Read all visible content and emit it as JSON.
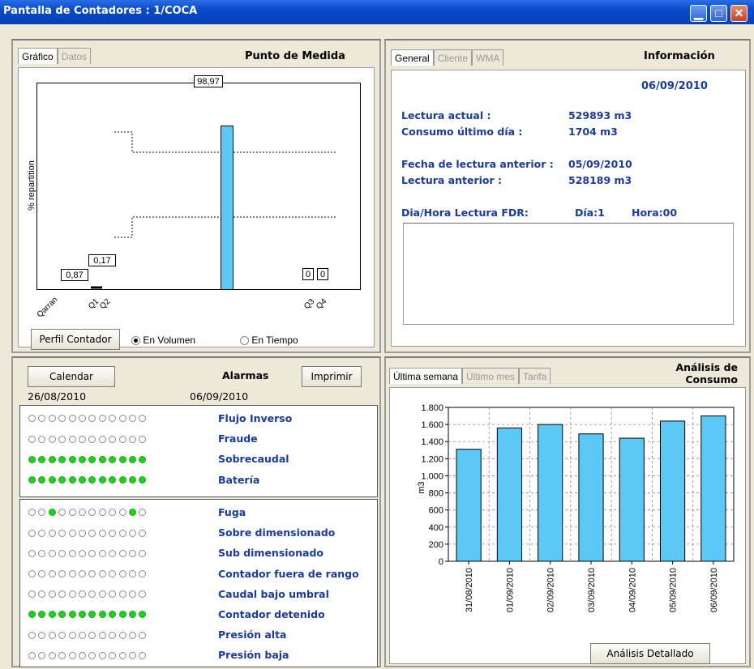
{
  "window": {
    "title": "Pantalla de Contadores : 1/COCA"
  },
  "icons": {
    "minimize": "minimize-icon",
    "maximize": "maximize-icon",
    "close": "close-icon"
  },
  "punto": {
    "title": "Punto de Medida",
    "tabs": [
      {
        "label": "Gráfico",
        "active": true
      },
      {
        "label": "Datos",
        "active": false
      }
    ],
    "ylabel": "% repartition",
    "value_labels": [
      "0,87",
      "0,17",
      "98,97",
      "0",
      "0"
    ],
    "ticks": [
      "Qarran",
      "Q1",
      "Q2",
      "Q3",
      "Q4"
    ],
    "bar_percent": 98.97,
    "perfil_button": "Perfil Contador",
    "radio_volumen": "En Volumen",
    "radio_tiempo": "En Tiempo",
    "selected": "En Volumen"
  },
  "info": {
    "title": "Información",
    "tabs": [
      {
        "label": "General",
        "active": true
      },
      {
        "label": "Cliente",
        "active": false
      },
      {
        "label": "WMA",
        "active": false
      }
    ],
    "date": "06/09/2010",
    "lectura_actual_label": "Lectura actual :",
    "lectura_actual_value": "529893 m3",
    "consumo_label": "Consumo último día :",
    "consumo_value": "1704 m3",
    "fecha_anterior_label": "Fecha de lectura anterior :",
    "fecha_anterior_value": "05/09/2010",
    "lectura_anterior_label": "Lectura anterior :",
    "lectura_anterior_value": "528189 m3",
    "fdr_label": "Dia/Hora Lectura FDR:",
    "fdr_dia": "Día:1",
    "fdr_hora": "Hora:00"
  },
  "alarmas": {
    "title": "Alarmas",
    "calendar_button": "Calendar",
    "print_button": "Imprimir",
    "date_from": "26/08/2010",
    "date_to": "06/09/2010",
    "group1": [
      {
        "label": "Flujo Inverso",
        "dots": [
          0,
          0,
          0,
          0,
          0,
          0,
          0,
          0,
          0,
          0,
          0,
          0
        ]
      },
      {
        "label": "Fraude",
        "dots": [
          0,
          0,
          0,
          0,
          0,
          0,
          0,
          0,
          0,
          0,
          0,
          0
        ]
      },
      {
        "label": "Sobrecaudal",
        "dots": [
          1,
          1,
          1,
          1,
          1,
          1,
          1,
          1,
          1,
          1,
          1,
          1
        ]
      },
      {
        "label": "Batería",
        "dots": [
          1,
          1,
          1,
          1,
          1,
          1,
          1,
          1,
          1,
          1,
          1,
          1
        ]
      }
    ],
    "group2": [
      {
        "label": "Fuga",
        "dots": [
          0,
          0,
          1,
          0,
          0,
          0,
          0,
          0,
          0,
          0,
          1,
          0
        ]
      },
      {
        "label": "Sobre dimensionado",
        "dots": [
          0,
          0,
          0,
          0,
          0,
          0,
          0,
          0,
          0,
          0,
          0,
          0
        ]
      },
      {
        "label": "Sub dimensionado",
        "dots": [
          0,
          0,
          0,
          0,
          0,
          0,
          0,
          0,
          0,
          0,
          0,
          0
        ]
      },
      {
        "label": "Contador fuera de rango",
        "dots": [
          0,
          0,
          0,
          0,
          0,
          0,
          0,
          0,
          0,
          0,
          0,
          0
        ]
      },
      {
        "label": "Caudal bajo umbral",
        "dots": [
          0,
          0,
          0,
          0,
          0,
          0,
          0,
          0,
          0,
          0,
          0,
          0
        ]
      },
      {
        "label": "Contador detenido",
        "dots": [
          1,
          1,
          1,
          1,
          1,
          1,
          1,
          1,
          1,
          1,
          1,
          1
        ]
      },
      {
        "label": "Presión alta",
        "dots": [
          0,
          0,
          0,
          0,
          0,
          0,
          0,
          0,
          0,
          0,
          0,
          0
        ]
      },
      {
        "label": "Presión baja",
        "dots": [
          0,
          0,
          0,
          0,
          0,
          0,
          0,
          0,
          0,
          0,
          0,
          0
        ]
      }
    ]
  },
  "consumo": {
    "title_line1": "Análisis de",
    "title_line2": "Consumo",
    "tabs": [
      {
        "label": "Última semana",
        "active": true
      },
      {
        "label": "Último mes",
        "active": false
      },
      {
        "label": "Tarifa",
        "active": false
      }
    ],
    "detail_button": "Análisis Detallado"
  },
  "chart_data": {
    "type": "bar",
    "categories": [
      "31/08/2010",
      "01/09/2010",
      "02/09/2010",
      "03/09/2010",
      "04/09/2010",
      "05/09/2010",
      "06/09/2010"
    ],
    "values": [
      1310,
      1560,
      1600,
      1490,
      1440,
      1640,
      1700
    ],
    "ylabel": "m3",
    "ylim": [
      0,
      1800
    ],
    "yticks": [
      "0",
      "200",
      "400",
      "600",
      "800",
      "1.000",
      "1.200",
      "1.400",
      "1.600",
      "1.800"
    ],
    "grid": true,
    "bar_color": "#5bc8f5"
  }
}
